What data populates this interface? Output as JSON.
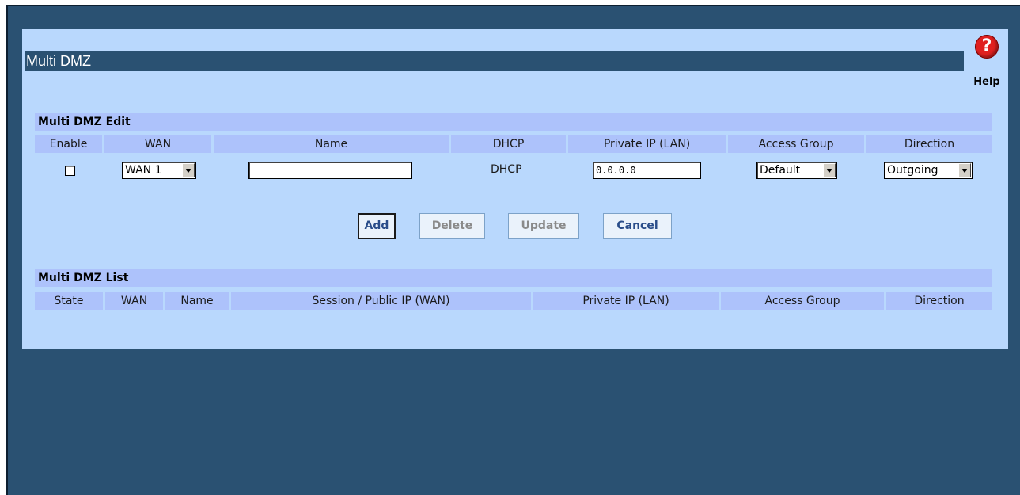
{
  "page": {
    "title": "Multi DMZ",
    "help_label": "Help",
    "help_glyph": "?"
  },
  "edit": {
    "heading": "Multi DMZ Edit",
    "columns": [
      "Enable",
      "WAN",
      "Name",
      "DHCP",
      "Private IP (LAN)",
      "Access Group",
      "Direction"
    ],
    "enable_checked": false,
    "wan_value": "WAN 1",
    "name_value": "",
    "dhcp_text": "DHCP",
    "private_ip_value": "0.0.0.0",
    "access_group_value": "Default",
    "direction_value": "Outgoing"
  },
  "buttons": {
    "add": "Add",
    "delete": "Delete",
    "update": "Update",
    "cancel": "Cancel"
  },
  "list": {
    "heading": "Multi DMZ List",
    "columns": [
      "State",
      "WAN",
      "Name",
      "Session / Public IP (WAN)",
      "Private IP (LAN)",
      "Access Group",
      "Direction"
    ],
    "rows": []
  },
  "colors": {
    "frame": "#2a5172",
    "panel": "#b9d8fd",
    "header_cell": "#adc2fb",
    "help_red": "#e02020"
  }
}
